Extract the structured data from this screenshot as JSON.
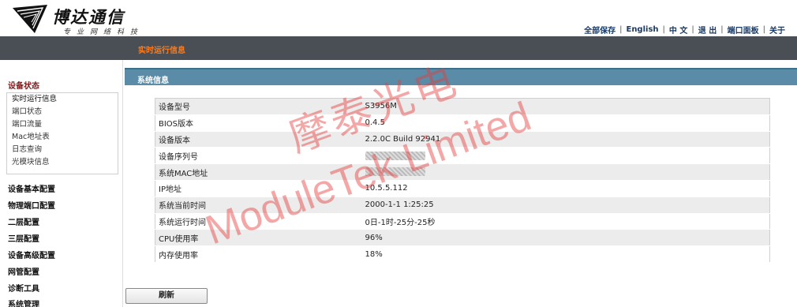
{
  "logo": {
    "title": "博达通信",
    "subtitle": "专业网络科技"
  },
  "top_links": [
    "全部保存",
    "English",
    "中 文",
    "退 出",
    "端口面板",
    "关于"
  ],
  "nav": {
    "active_tab": "实时运行信息"
  },
  "sidebar": {
    "section_title": "设备状态",
    "sub_items": [
      "实时运行信息",
      "端口状态",
      "端口流量",
      "Mac地址表",
      "日志查询",
      "光模块信息"
    ],
    "groups": [
      "设备基本配置",
      "物理端口配置",
      "二层配置",
      "三层配置",
      "设备高级配置",
      "网管配置",
      "诊断工具",
      "系统管理"
    ]
  },
  "panel": {
    "title": "系统信息"
  },
  "system_info": [
    {
      "key": "设备型号",
      "value": "S3956M"
    },
    {
      "key": "BIOS版本",
      "value": "0.4.5"
    },
    {
      "key": "设备版本",
      "value": "2.2.0C Build 92941"
    },
    {
      "key": "设备序列号",
      "value": ""
    },
    {
      "key": "系统MAC地址",
      "value": ""
    },
    {
      "key": "IP地址",
      "value": "10.5.5.112"
    },
    {
      "key": "系统当前时间",
      "value": "2000-1-1 1:25:25"
    },
    {
      "key": "系统运行时间",
      "value": "0日-1时-25分-25秒"
    },
    {
      "key": "CPU使用率",
      "value": "96%"
    },
    {
      "key": "内存使用率",
      "value": "18%"
    }
  ],
  "buttons": {
    "refresh": "刷新"
  },
  "watermark": {
    "line1": "摩泰光电",
    "line2": "ModuleTek Limited"
  }
}
